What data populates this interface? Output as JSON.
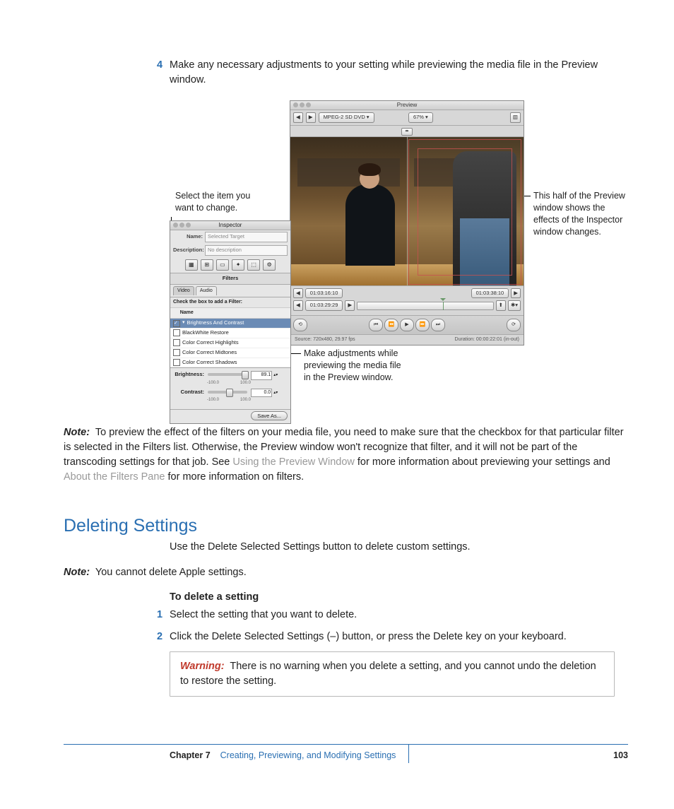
{
  "step4": {
    "num": "4",
    "text": "Make any necessary adjustments to your setting while previewing the media file in the Preview window."
  },
  "callouts": {
    "left": "Select the item you want to change.",
    "right": "This half of the Preview window shows the effects of the Inspector window changes.",
    "bottom": "Make adjustments while previewing the media file in the Preview window."
  },
  "preview": {
    "title": "Preview",
    "format": "MPEG-2 SD DVD",
    "zoom": "67%",
    "tc_left": "01:03:29:29",
    "tc_top_left": "01:03:16:10",
    "tc_top_right": "01:03:38:10",
    "source": "Source: 720x480, 29.97 fps",
    "duration": "Duration: 00:00:22:01 (in-out)"
  },
  "inspector": {
    "title": "Inspector",
    "name_label": "Name:",
    "name_value": "Selected Target",
    "desc_label": "Description:",
    "desc_value": "No description",
    "section": "Filters",
    "tab_video": "Video",
    "tab_audio": "Audio",
    "filter_head": "Check the box to add a Filter:",
    "col": "Name",
    "filters": [
      "Brightness And Contrast",
      "BlackWhite Restore",
      "Color Correct Highlights",
      "Color Correct Midtones",
      "Color Correct Shadows"
    ],
    "brightness_label": "Brightness:",
    "brightness_value": "89.1",
    "contrast_label": "Contrast:",
    "contrast_value": "0.0",
    "scale_min": "-100.0",
    "scale_max": "100.0",
    "save": "Save As..."
  },
  "note1": {
    "label": "Note:",
    "t1": "To preview the effect of the filters on your media file, you need to make sure that the checkbox for that particular filter is selected in the Filters list. Otherwise, the Preview window won't recognize that filter, and it will not be part of the transcoding settings for that job. See ",
    "link1": "Using the Preview Window",
    "t2": " for more information about previewing your settings and ",
    "link2": "About the Filters Pane",
    "t3": " for more information on filters."
  },
  "heading": "Deleting Settings",
  "intro": "Use the Delete Selected Settings button to delete custom settings.",
  "note2": {
    "label": "Note:",
    "text": "You cannot delete Apple settings."
  },
  "subhead": "To delete a setting",
  "step_d1": {
    "num": "1",
    "text": "Select the setting that you want to delete."
  },
  "step_d2": {
    "num": "2",
    "text": "Click the Delete Selected Settings (–) button, or press the Delete key on your keyboard."
  },
  "warning": {
    "label": "Warning:",
    "text": "There is no warning when you delete a setting, and you cannot undo the deletion to restore the setting."
  },
  "footer": {
    "chapter": "Chapter 7",
    "title": "Creating, Previewing, and Modifying Settings",
    "page": "103"
  }
}
